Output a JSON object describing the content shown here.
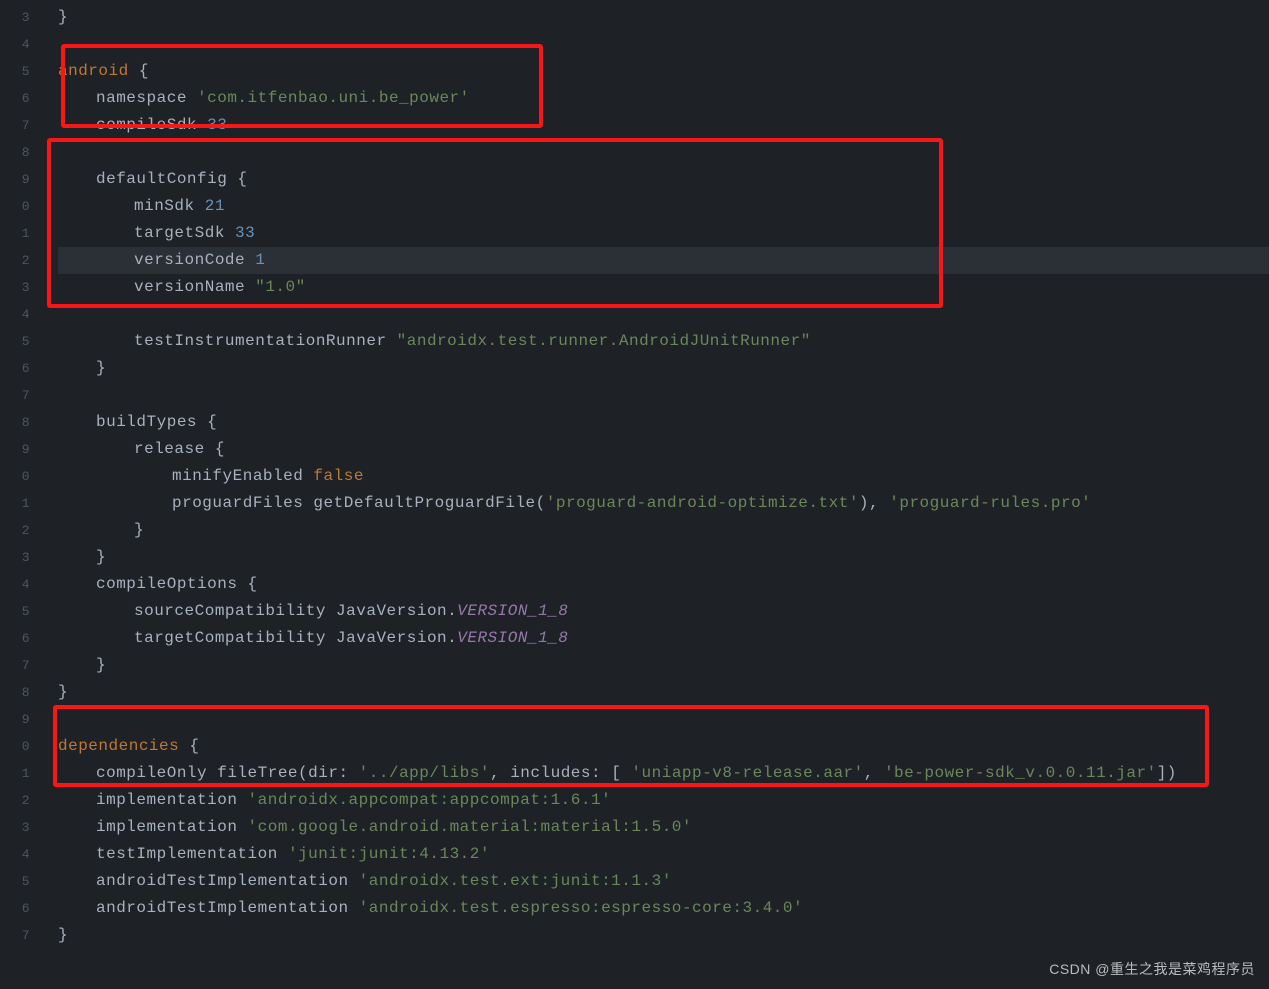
{
  "gutter_start": 3,
  "watermark": "CSDN @重生之我是菜鸡程序员",
  "lines": {
    "l3": "}",
    "l4": "",
    "l5_kw": "android",
    "l5_pl": " {",
    "l6_a": "namespace ",
    "l6_s": "'com.itfenbao.uni.be_power'",
    "l7_a": "compileSdk ",
    "l7_n": "33",
    "l8": "",
    "l9_a": "defaultConfig ",
    "l9_b": "{",
    "l10_a": "minSdk ",
    "l10_n": "21",
    "l11_a": "targetSdk ",
    "l11_n": "33",
    "l12_a": "versionCode ",
    "l12_n": "1",
    "l13_a": "versionName ",
    "l13_s": "\"1.0\"",
    "l14": "",
    "l15_a": "testInstrumentationRunner ",
    "l15_s": "\"androidx.test.runner.AndroidJUnitRunner\"",
    "l16": "}",
    "l17": "",
    "l18_a": "buildTypes ",
    "l18_b": "{",
    "l19_a": "release ",
    "l19_b": "{",
    "l20_a": "minifyEnabled ",
    "l20_k": "false",
    "l21_a": "proguardFiles getDefaultProguardFile(",
    "l21_s1": "'proguard-android-optimize.txt'",
    "l21_b": "), ",
    "l21_s2": "'proguard-rules.pro'",
    "l22": "}",
    "l23": "}",
    "l24_a": "compileOptions ",
    "l24_b": "{",
    "l25_a": "sourceCompatibility JavaVersion.",
    "l25_i": "VERSION_1_8",
    "l26_a": "targetCompatibility JavaVersion.",
    "l26_i": "VERSION_1_8",
    "l27": "}",
    "l28": "}",
    "l29": "",
    "l30_k": "dependencies",
    "l30_b": " {",
    "l31_a": "compileOnly fileTree(",
    "l31_p1": "dir",
    "l31_b1": ": ",
    "l31_s1": "'../app/libs'",
    "l31_b2": ", ",
    "l31_p2": "includes",
    "l31_b3": ": [ ",
    "l31_s2": "'uniapp-v8-release.aar'",
    "l31_b4": ", ",
    "l31_s3": "'be-power-sdk_v.0.0.11.jar'",
    "l31_b5": "])",
    "l32_a": "implementation ",
    "l32_s": "'androidx.appcompat:appcompat:1.6.1'",
    "l33_a": "implementation ",
    "l33_s": "'com.google.android.material:material:1.5.0'",
    "l34_a": "testImplementation ",
    "l34_s": "'junit:junit:4.13.2'",
    "l35_a": "androidTestImplementation ",
    "l35_s": "'androidx.test.ext:junit:1.1.3'",
    "l36_a": "androidTestImplementation ",
    "l36_s": "'androidx.test.espresso:espresso-core:3.4.0'",
    "l37": "}"
  }
}
